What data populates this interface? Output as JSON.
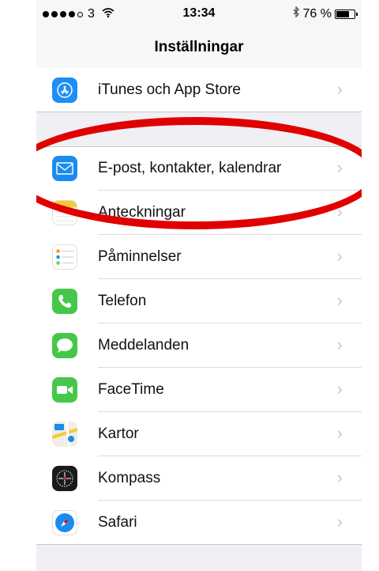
{
  "status": {
    "carrier": "3",
    "time": "13:34",
    "battery_text": "76 %",
    "battery_level": 0.76,
    "signal_bars": 4
  },
  "nav": {
    "title": "Inställningar"
  },
  "settings": [
    {
      "label": "iTunes och App Store",
      "icon": "app-store-icon",
      "color": "#1e8ef5"
    },
    {
      "label": "E-post, kontakter, kalendrar",
      "icon": "mail-icon",
      "color": "#1a8cf0"
    },
    {
      "label": "Anteckningar",
      "icon": "notes-icon",
      "color": "#f7c937"
    },
    {
      "label": "Påminnelser",
      "icon": "reminders-icon",
      "color": "#ffffff"
    },
    {
      "label": "Telefon",
      "icon": "phone-icon",
      "color": "#45c84a"
    },
    {
      "label": "Meddelanden",
      "icon": "messages-icon",
      "color": "#45c84a"
    },
    {
      "label": "FaceTime",
      "icon": "facetime-icon",
      "color": "#45c84a"
    },
    {
      "label": "Kartor",
      "icon": "maps-icon",
      "color": "#e6e6e6"
    },
    {
      "label": "Kompass",
      "icon": "compass-icon",
      "color": "#1a1a1a"
    },
    {
      "label": "Safari",
      "icon": "safari-icon",
      "color": "#ffffff"
    }
  ],
  "annotation": {
    "color": "#e00000"
  }
}
